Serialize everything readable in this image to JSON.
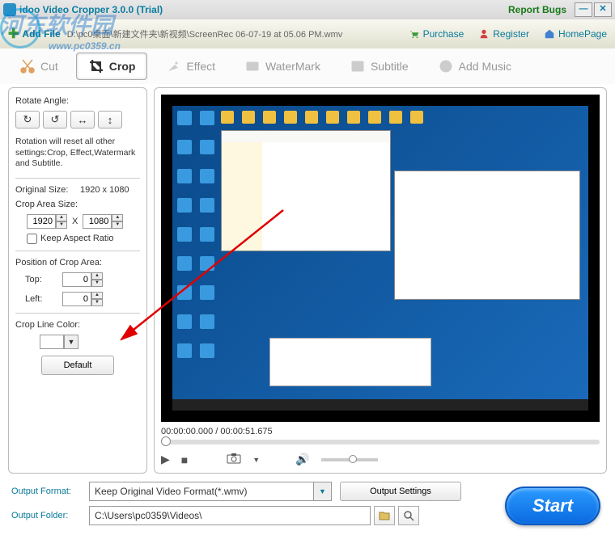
{
  "titlebar": {
    "title": "idoo Video Cropper 3.0.0 (Trial)",
    "report": "Report Bugs"
  },
  "header": {
    "addfile": "Add File",
    "filepath": "D:\\pc0桌面\\新建文件夹\\新视频\\ScreenRec 06-07-19 at 05.06 PM.wmv",
    "purchase": "Purchase",
    "register": "Register",
    "homepage": "HomePage"
  },
  "watermark": {
    "main": "河东软件园",
    "sub": "www.pc0359.cn"
  },
  "tabs": {
    "cut": "Cut",
    "crop": "Crop",
    "effect": "Effect",
    "watermark": "WaterMark",
    "subtitle": "Subtitle",
    "addmusic": "Add Music"
  },
  "left": {
    "rotate_angle": "Rotate Angle:",
    "note": "Rotation will reset all other settings:Crop, Effect,Watermark and Subtitle.",
    "original_size_label": "Original Size:",
    "original_size_value": "1920 x 1080",
    "crop_area_size": "Crop Area Size:",
    "crop_w": "1920",
    "crop_h": "1080",
    "x": "X",
    "keep_aspect": "Keep Aspect Ratio",
    "position_label": "Position of Crop Area:",
    "top_label": "Top:",
    "top_value": "0",
    "left_label": "Left:",
    "left_value": "0",
    "crop_line_color": "Crop Line Color:",
    "default_btn": "Default"
  },
  "preview": {
    "timecode_current": "00:00:00.000",
    "timecode_total": "00:00:51.675"
  },
  "bottom": {
    "output_format_label": "Output Format:",
    "output_format_value": "Keep Original Video Format(*.wmv)",
    "output_settings": "Output Settings",
    "output_folder_label": "Output Folder:",
    "output_folder_value": "C:\\Users\\pc0359\\Videos\\",
    "start": "Start"
  }
}
